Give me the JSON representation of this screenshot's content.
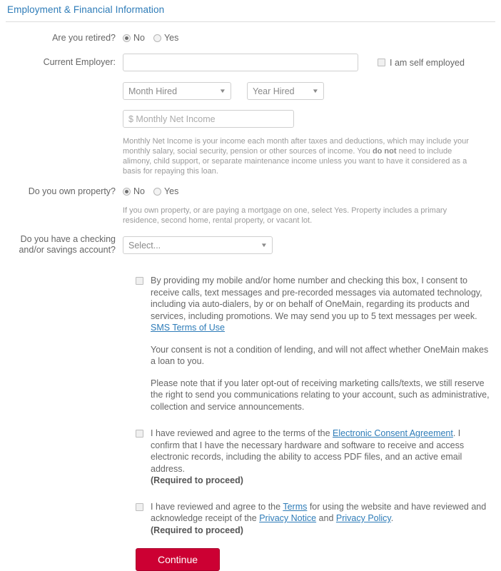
{
  "section": {
    "title": "Employment & Financial Information"
  },
  "retired": {
    "label": "Are you retired?",
    "options": [
      {
        "label": "No",
        "selected": true
      },
      {
        "label": "Yes",
        "selected": false
      }
    ]
  },
  "employer": {
    "label": "Current Employer:",
    "value": "",
    "placeholder": ""
  },
  "self_employed": {
    "label": "I am self employed",
    "checked": false
  },
  "month_hired": {
    "value": "Month Hired",
    "caret": "▼"
  },
  "year_hired": {
    "value": "Year Hired",
    "caret": "▼"
  },
  "monthly_net_income": {
    "value": "",
    "placeholder": "$ Monthly Net Income"
  },
  "income_help": {
    "part1": "Monthly Net Income is your income each month after taxes and deductions, which may include your monthly salary, social security, pension or other sources of income. You ",
    "emphasis": "do not",
    "part2": " need to include alimony, child support, or separate maintenance income unless you want to have it considered as a basis for repaying this loan."
  },
  "own_property": {
    "label": "Do you own property?",
    "options": [
      {
        "label": "No",
        "selected": true
      },
      {
        "label": "Yes",
        "selected": false
      }
    ],
    "help": "If you own property, or are paying a mortgage on one, select Yes. Property includes a primary residence, second home, rental property, or vacant lot."
  },
  "account": {
    "label_line1": "Do you have a checking",
    "label_line2": "and/or savings account?",
    "value": "Select...",
    "caret": "▼"
  },
  "consent_sms": {
    "checked": false,
    "text": "By providing my mobile and/or home number and checking this box, I consent to receive calls, text messages and pre-recorded messages via automated technology, including via auto-dialers, by or on behalf of OneMain, regarding its products and services, including promotions. We may send you up to 5 text messages per week. ",
    "link": "SMS Terms of Use",
    "para1": "Your consent is not a condition of lending, and will not affect whether OneMain makes a loan to you.",
    "para2": "Please note that if you later opt-out of receiving marketing calls/texts, we still reserve the right to send you communications relating to your account, such as administrative, collection and service announcements."
  },
  "consent_electronic": {
    "checked": false,
    "text_before": "I have reviewed and agree to the terms of the ",
    "link": "Electronic Consent Agreement",
    "text_after": ". I confirm that I have the necessary hardware and software to receive and access electronic records, including the ability to access PDF files, and an active email address.",
    "required": "(Required to proceed)"
  },
  "consent_terms": {
    "checked": false,
    "text_before": "I have reviewed and agree to the ",
    "link_terms": "Terms",
    "text_mid1": " for using the website and have reviewed and acknowledge receipt of the ",
    "link_privacy_notice": "Privacy Notice",
    "text_mid2": " and ",
    "link_privacy_policy": "Privacy Policy",
    "text_after": ".",
    "required": "(Required to proceed)"
  },
  "continue_button": {
    "label": "Continue"
  },
  "colors": {
    "accent_blue": "#2e7cb8",
    "button_red": "#cc0033",
    "text_gray": "#666666",
    "help_gray": "#9b9b9b"
  }
}
